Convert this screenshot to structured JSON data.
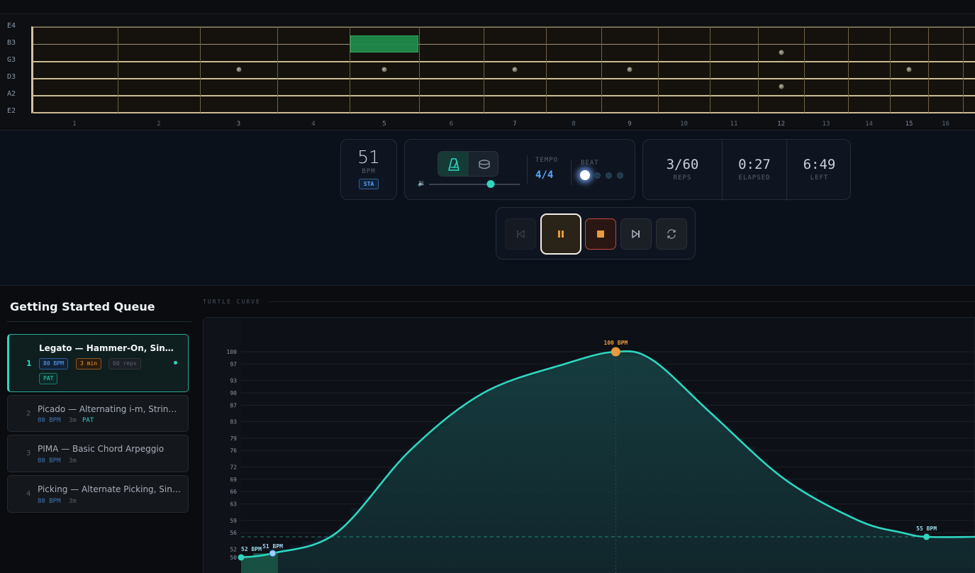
{
  "fretboard": {
    "strings": [
      "E4",
      "B3",
      "G3",
      "D3",
      "A2",
      "E2"
    ],
    "frets": [
      "1",
      "2",
      "3",
      "4",
      "5",
      "6",
      "7",
      "8",
      "9",
      "10",
      "11",
      "12",
      "13",
      "14",
      "15",
      "16"
    ],
    "inlay_frets": [
      3,
      5,
      7,
      9,
      12,
      15
    ],
    "highlighted_note": {
      "string": "B3",
      "fret": 5
    }
  },
  "tempo": {
    "bpm": "51",
    "bpm_label": "BPM",
    "mode": "STA",
    "tempo_label": "TEMPO",
    "time_signature": "4/4",
    "beat_label": "BEAT",
    "volume": 0.68,
    "beat_count": 4,
    "current_beat": 1
  },
  "stats": {
    "reps_value": "3/60",
    "reps_label": "REPS",
    "elapsed_value": "0:27",
    "elapsed_label": "ELAPSED",
    "left_value": "6:49",
    "left_label": "LEFT"
  },
  "icons": {
    "sound_metronome": "metronome-icon",
    "sound_drum": "drum-icon",
    "volume": "speaker-icon",
    "prev": "skip-back-icon",
    "pause": "pause-icon",
    "stop": "stop-icon",
    "next": "skip-forward-icon",
    "loop": "repeat-icon"
  },
  "colors": {
    "accent": "#2ed6c0",
    "tempo_blue": "#56a8ff",
    "peak_orange": "#e99a3c",
    "stop_red": "#c4483a"
  },
  "queue": {
    "title": "Getting Started Queue",
    "items": [
      {
        "num": "1",
        "title": "Legato — Hammer-On, Singl...",
        "bpm": "80 BPM",
        "duration": "3 min",
        "reps": "60 reps",
        "tag": "PAT",
        "active": true
      },
      {
        "num": "2",
        "title": "Picado — Alternating i-m, Strings...",
        "bpm": "80 BPM",
        "duration": "3m",
        "tag": "PAT"
      },
      {
        "num": "3",
        "title": "PIMA — Basic Chord Arpeggio",
        "bpm": "80 BPM",
        "duration": "3m"
      },
      {
        "num": "4",
        "title": "Picking — Alternate Picking, Sing...",
        "bpm": "80 BPM",
        "duration": "3m"
      }
    ]
  },
  "chart_data": {
    "type": "line",
    "title": "TURTLE CURVE",
    "ylabel": "",
    "xlabel": "",
    "y_ticks": [
      50,
      52,
      56,
      59,
      63,
      66,
      69,
      72,
      76,
      79,
      83,
      87,
      90,
      93,
      97,
      100
    ],
    "ylim": [
      48,
      104
    ],
    "x_range": [
      0,
      1
    ],
    "series": [
      {
        "values": [
          {
            "x": 0.0,
            "y": 50
          },
          {
            "x": 0.043,
            "y": 51
          },
          {
            "x": 0.13,
            "y": 56
          },
          {
            "x": 0.23,
            "y": 76
          },
          {
            "x": 0.33,
            "y": 90
          },
          {
            "x": 0.44,
            "y": 97
          },
          {
            "x": 0.51,
            "y": 100
          },
          {
            "x": 0.56,
            "y": 98
          },
          {
            "x": 0.64,
            "y": 85
          },
          {
            "x": 0.74,
            "y": 69
          },
          {
            "x": 0.84,
            "y": 59
          },
          {
            "x": 0.9,
            "y": 56
          },
          {
            "x": 0.933,
            "y": 55
          },
          {
            "x": 1.0,
            "y": 55
          }
        ]
      }
    ],
    "baseline_bpm": 55,
    "markers": [
      {
        "x": 0.0,
        "y": 50,
        "label": "52 BPM"
      },
      {
        "x": 0.043,
        "y": 51,
        "label": "51 BPM",
        "current": true
      },
      {
        "x": 0.51,
        "y": 100,
        "label": "100 BPM",
        "peak": true
      },
      {
        "x": 0.933,
        "y": 55,
        "label": "55 BPM"
      }
    ],
    "grid": true
  }
}
